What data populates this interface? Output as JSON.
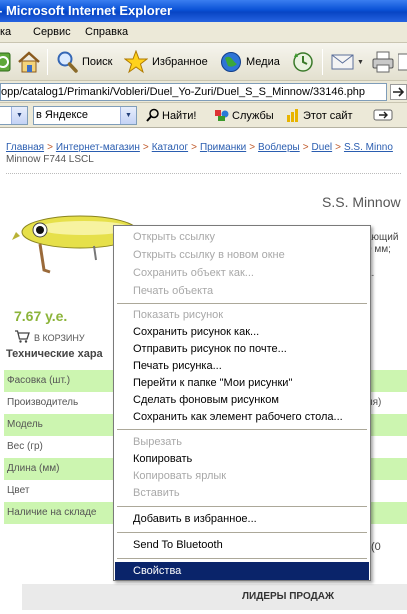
{
  "window": {
    "title": "- Microsoft Internet Explorer"
  },
  "menubar": {
    "items": [
      "ка",
      "Сервис",
      "Справка"
    ]
  },
  "toolbar": {
    "search_label": "Поиск",
    "favorites_label": "Избранное",
    "media_label": "Медиа"
  },
  "address": {
    "url": "opp/catalog1/Primanki/Vobleri/Duel_Yo-Zuri/Duel_S_S_Minnow/33146.php"
  },
  "yandex": {
    "search_scope": "в Яндексе",
    "find_label": "Найти!",
    "services_label": "Службы",
    "this_site_label": "Этот сайт"
  },
  "page": {
    "breadcrumb": [
      "Главная",
      "Интернет-магазин",
      "Каталог",
      "Приманки",
      "Воблеры",
      "Duel",
      "S.S. Minno"
    ],
    "breadcrumb_tail": "Minnow F744 LSCL",
    "product_title": "S.S. Minnow",
    "desc_fragments": [
      "ающий",
      "0 мм;",
      "L."
    ],
    "price": "7.67 у.е.",
    "cart_label": "В КОРЗИНУ",
    "specs_title": "Технические хара",
    "specs": [
      {
        "label": "Фасовка (шт.)",
        "value": ""
      },
      {
        "label": "Производитель",
        "value": "ия)"
      },
      {
        "label": "Модель",
        "value": ""
      },
      {
        "label": "Вес (гр)",
        "value": ""
      },
      {
        "label": "Длина (мм)",
        "value": ""
      },
      {
        "label": "Цвет",
        "value": ""
      },
      {
        "label": "Наличие на складе",
        "value": ""
      }
    ],
    "zero_fragment": "(0",
    "leaders_label": "ЛИДЕРЫ ПРОДАЖ"
  },
  "context_menu": {
    "items": [
      {
        "label": "Открыть ссылку",
        "enabled": false
      },
      {
        "label": "Открыть ссылку в новом окне",
        "enabled": false
      },
      {
        "label": "Сохранить объект как...",
        "enabled": false
      },
      {
        "label": "Печать объекта",
        "enabled": false
      },
      {
        "label": "Показать рисунок",
        "enabled": false
      },
      {
        "label": "Сохранить рисунок как...",
        "enabled": true
      },
      {
        "label": "Отправить рисунок по почте...",
        "enabled": true
      },
      {
        "label": "Печать рисунка...",
        "enabled": true
      },
      {
        "label": "Перейти к папке \"Мои рисунки\"",
        "enabled": true
      },
      {
        "label": "Сделать фоновым рисунком",
        "enabled": true
      },
      {
        "label": "Сохранить как элемент рабочего стола...",
        "enabled": true
      },
      {
        "label": "Вырезать",
        "enabled": false
      },
      {
        "label": "Копировать",
        "enabled": true
      },
      {
        "label": "Копировать ярлык",
        "enabled": false
      },
      {
        "label": "Вставить",
        "enabled": false
      },
      {
        "label": "Добавить в избранное...",
        "enabled": true
      },
      {
        "label": "Send To Bluetooth",
        "enabled": true
      },
      {
        "label": "Свойства",
        "enabled": true,
        "highlighted": true
      }
    ]
  },
  "colors": {
    "title_blue": "#0a52d6",
    "highlight": "#0a246a",
    "spec_green": "#ccf5b0",
    "price_green": "#8cb43a",
    "link_blue": "#2a5db0"
  }
}
